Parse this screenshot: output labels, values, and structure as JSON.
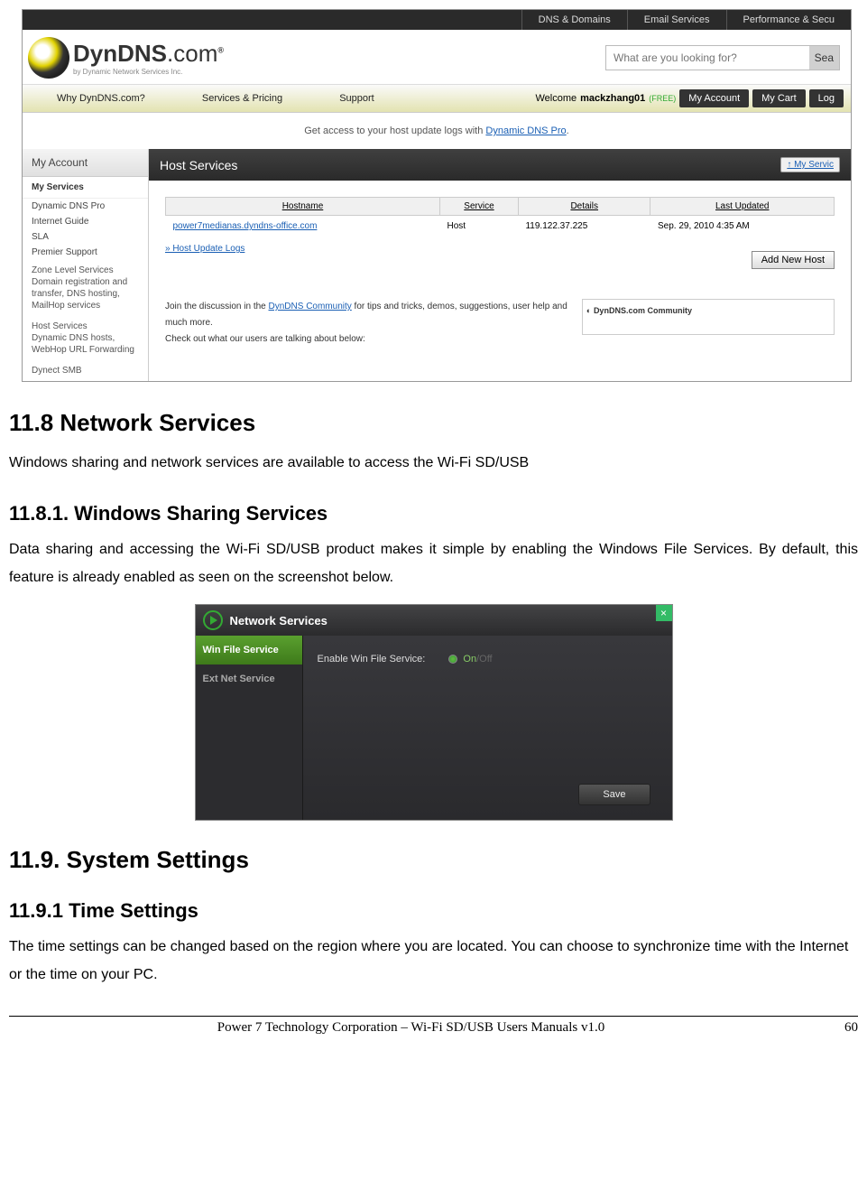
{
  "dyndns": {
    "topbar": [
      "DNS & Domains",
      "Email Services",
      "Performance & Secu"
    ],
    "logo_name": "DynDNS",
    "logo_tld": ".com",
    "logo_sub": "by Dynamic Network Services Inc.",
    "search_placeholder": "What are you looking for?",
    "search_btn": "Sea",
    "nav_left": [
      "Why DynDNS.com?",
      "Services & Pricing",
      "Support"
    ],
    "welcome_prefix": "Welcome ",
    "welcome_user": "mackzhang01",
    "welcome_tag": "(FREE)",
    "nav_buttons": [
      "My Account",
      "My Cart",
      "Log"
    ],
    "promo_pre": "Get access to your host update logs with ",
    "promo_link": "Dynamic DNS Pro",
    "sidebar_head": "My Account",
    "sidebar_sub": "My Services",
    "sidebar_items": [
      "Dynamic DNS Pro",
      "Internet Guide",
      "SLA",
      "Premier Support"
    ],
    "sidebar_group1_title": "Zone Level Services",
    "sidebar_group1_text": "Domain registration and transfer, DNS hosting, MailHop services",
    "sidebar_group2_title": "Host Services",
    "sidebar_group2_text": "Dynamic DNS hosts, WebHop URL Forwarding",
    "sidebar_group3_title": "Dynect SMB",
    "main_head": "Host Services",
    "main_head_link": "↑ My Servic",
    "table_headers": [
      "Hostname",
      "Service",
      "Details",
      "Last Updated"
    ],
    "table_row": {
      "hostname": "power7medianas.dyndns-office.com",
      "service": "Host",
      "details": "119.122.37.225",
      "updated": "Sep. 29, 2010 4:35 AM"
    },
    "host_update_link": "» Host Update Logs",
    "add_host_btn": "Add New Host",
    "discussion1_pre": "Join the discussion in the ",
    "discussion1_link": "DynDNS Community",
    "discussion1_post": " for tips and tricks, demos, suggestions, user help and much more.",
    "discussion2": "Check out what our users are talking about below:",
    "community_label": "DynDNS.com  Community"
  },
  "doc": {
    "h_118": "11.8 Network Services",
    "p_118": "Windows sharing and network services are available to access the Wi-Fi SD/USB",
    "h_1181": "11.8.1. Windows Sharing Services",
    "p_1181": "Data sharing and accessing the Wi-Fi SD/USB product makes it simple by enabling the Windows File Services.   By default, this feature is already enabled as seen on the screenshot below.",
    "h_119": "11.9. System Settings",
    "h_1191": "11.9.1 Time Settings",
    "p_1191": "The time settings can be changed based on the region where you are located.   You can choose to synchronize time with the Internet or the time on your PC."
  },
  "ns": {
    "title": "Network Services",
    "side_active": "Win File Service",
    "side_inactive": "Ext Net Service",
    "label": "Enable Win File Service:",
    "on": "On",
    "off": "Off",
    "save": "Save",
    "close": "×"
  },
  "footer": {
    "text": "Power 7 Technology Corporation – Wi-Fi SD/USB Users Manuals v1.0",
    "page": "60"
  }
}
